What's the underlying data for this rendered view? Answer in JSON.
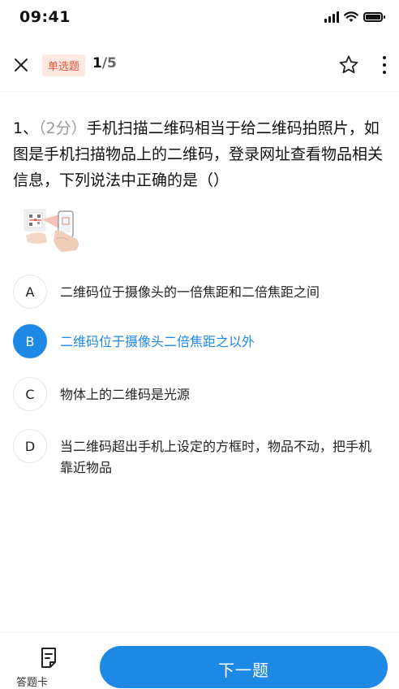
{
  "status_bar": {
    "time": "09:41"
  },
  "header": {
    "question_type": "单选题",
    "progress_current": "1",
    "progress_total": "/5",
    "icons": [
      "close-icon",
      "star-icon",
      "more-vertical-icon"
    ]
  },
  "question": {
    "number": "1、",
    "points": "（2分）",
    "text": "手机扫描二维码相当于给二维码拍照片，如图是手机扫描物品上的二维码，登录网址查看物品相关信息，下列说法中正确的是（）"
  },
  "options": [
    {
      "letter": "A",
      "text": "二维码位于摄像头的一倍焦距和二倍焦距之间",
      "selected": false
    },
    {
      "letter": "B",
      "text": "二维码位于摄像头二倍焦距之以外",
      "selected": true
    },
    {
      "letter": "C",
      "text": "物体上的二维码是光源",
      "selected": false
    },
    {
      "letter": "D",
      "text": "当二维码超出手机上设定的方框时，物品不动，把手机靠近物品",
      "selected": false
    }
  ],
  "bottom_bar": {
    "answer_card_label": "答题卡",
    "next_button_label": "下一题"
  },
  "colors": {
    "accent": "#1e88e5",
    "badge_bg": "#fde8e2",
    "badge_text": "#e8553b"
  }
}
